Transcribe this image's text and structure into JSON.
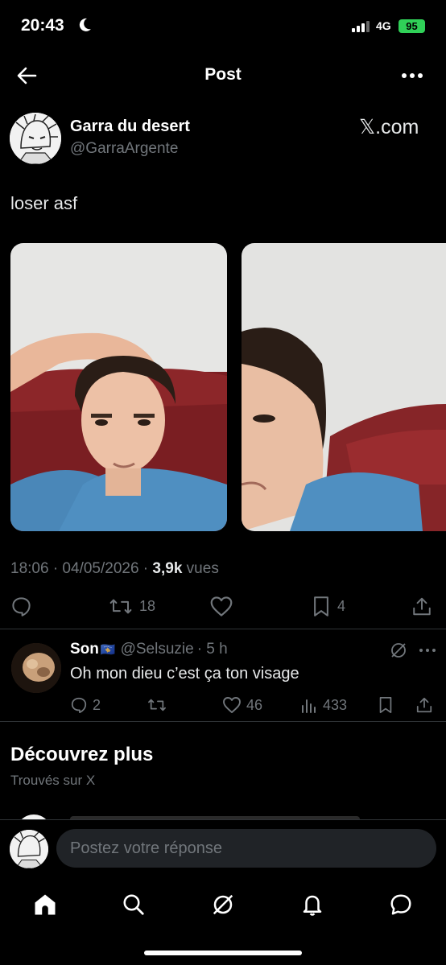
{
  "status_bar": {
    "time": "20:43",
    "network": "4G",
    "battery": "95"
  },
  "header": {
    "title": "Post",
    "back_icon": "arrow-left-icon",
    "more_icon": "more-horizontal-icon"
  },
  "post": {
    "author_name": "Garra du desert",
    "author_handle": "@GarraArgente",
    "source": "𝕏.com",
    "text": "loser asf",
    "timestamp": "18:06 · 04/05/2026 · ",
    "views_count": "3,9k",
    "views_label": " vues",
    "stats": {
      "replies": "",
      "reposts": "18",
      "likes": "",
      "bookmarks": "4"
    }
  },
  "reply": {
    "name": "Son",
    "flag": "🇽🇰",
    "handle": "@Selsuzie",
    "age": "· 5 h",
    "text": "Oh mon dieu c’est ça ton visage",
    "stats": {
      "replies": "2",
      "reposts": "",
      "likes": "46",
      "views": "433"
    }
  },
  "discover": {
    "title": "Découvrez plus",
    "subtitle": "Trouvés sur X"
  },
  "composer": {
    "placeholder": "Postez votre réponse"
  },
  "nav": [
    "home-icon",
    "search-icon",
    "grok-icon",
    "bell-icon",
    "messages-icon"
  ],
  "colors": {
    "background": "#000000",
    "muted": "#71767b",
    "text": "#e7e9ea",
    "battery": "#30d158",
    "divider": "#2f3336"
  }
}
